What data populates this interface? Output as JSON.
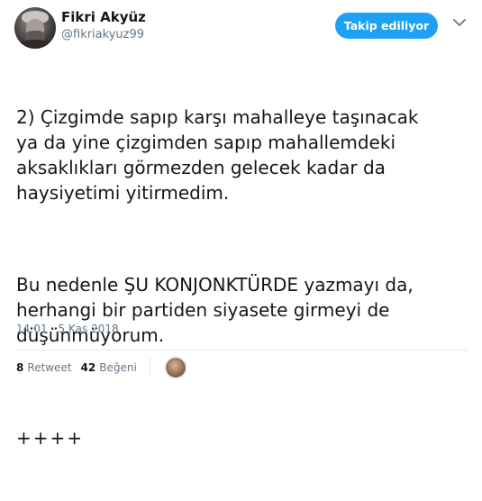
{
  "author": {
    "name": "Fikri Akyüz",
    "handle": "@fikriakyuz99"
  },
  "follow_button": {
    "label": "Takip ediliyor"
  },
  "tweet": {
    "paragraph1": "2) Çizgimde sapıp karşı mahalleye taşınacak\nya da yine çizgimden sapıp mahallemdeki\naksaklıkları görmezden gelecek kadar da\nhaysiyetimi yitirmedim.",
    "paragraph2": "Bu nedenle ŞU KONJONKTÜRDE yazmayı da,\nherhangi bir partiden siyasete girmeyi de\ndüşünmüyorum.",
    "paragraph3": "++++",
    "timestamp": "14:01 - 5 Kas 2018"
  },
  "stats": {
    "retweets_count": "8",
    "retweets_label": "Retweet",
    "likes_count": "42",
    "likes_label": "Beğeni"
  },
  "icons": {
    "avatar": "profile-photo",
    "menu": "chevron-down-icon",
    "liker": "liker-avatar"
  },
  "colors": {
    "accent": "#1da1f2",
    "secondary_text": "#657786",
    "divider": "#e6ecf0"
  }
}
